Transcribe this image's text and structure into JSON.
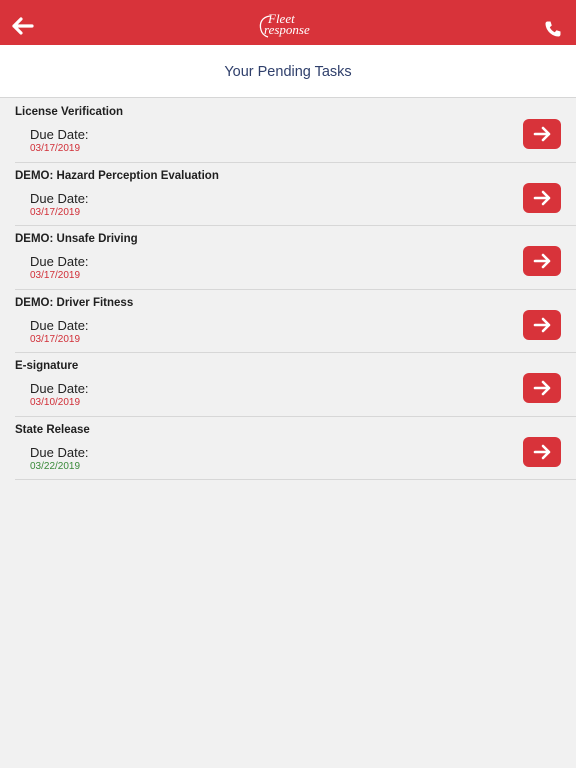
{
  "header": {
    "logo_line1": "Fleet",
    "logo_line2": "response",
    "back_icon": "arrow-left-icon",
    "phone_icon": "phone-icon",
    "brand_color": "#d8333a"
  },
  "page": {
    "title": "Your Pending Tasks"
  },
  "tasks": [
    {
      "name": "License Verification",
      "due_label": "Due Date:",
      "due_date": "03/17/2019",
      "date_color": "#d12f38"
    },
    {
      "name": "DEMO: Hazard Perception Evaluation",
      "due_label": "Due Date:",
      "due_date": "03/17/2019",
      "date_color": "#d12f38"
    },
    {
      "name": "DEMO: Unsafe Driving",
      "due_label": "Due Date:",
      "due_date": "03/17/2019",
      "date_color": "#d12f38"
    },
    {
      "name": "DEMO: Driver Fitness",
      "due_label": "Due Date:",
      "due_date": "03/17/2019",
      "date_color": "#d12f38"
    },
    {
      "name": "E-signature",
      "due_label": "Due Date:",
      "due_date": "03/10/2019",
      "date_color": "#d12f38"
    },
    {
      "name": "State Release",
      "due_label": "Due Date:",
      "due_date": "03/22/2019",
      "date_color": "#3a8a3a"
    }
  ]
}
